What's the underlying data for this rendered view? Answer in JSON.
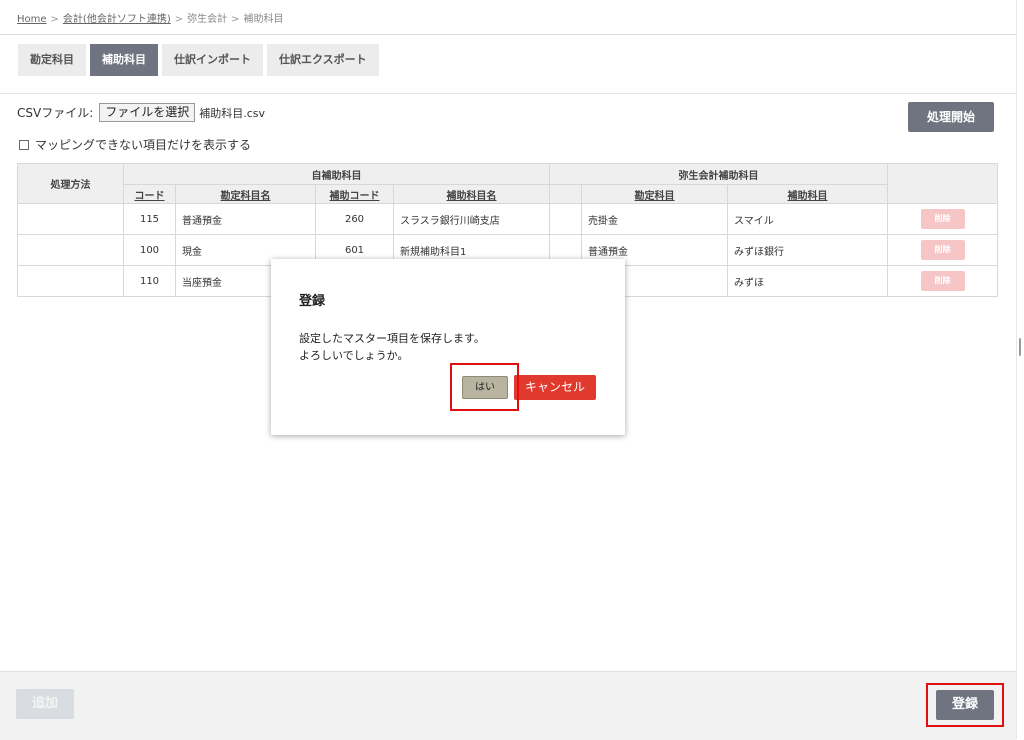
{
  "breadcrumb": {
    "home": "Home",
    "accounting": "会計(他会計ソフト連携)",
    "yayoi": "弥生会計",
    "current": "補助科目",
    "separator": ">"
  },
  "tabs": [
    {
      "label": "勘定科目",
      "active": false
    },
    {
      "label": "補助科目",
      "active": true
    },
    {
      "label": "仕訳インポート",
      "active": false
    },
    {
      "label": "仕訳エクスポート",
      "active": false
    }
  ],
  "csv": {
    "label": "CSVファイル:",
    "button": "ファイルを選択",
    "filename": "補助科目.csv"
  },
  "filter": {
    "label": "マッピングできない項目だけを表示する",
    "checked": false
  },
  "start_button": "処理開始",
  "table": {
    "group_headers": {
      "method": "処理方法",
      "own": "自補助科目",
      "yayoi": "弥生会計補助科目"
    },
    "columns": {
      "code": "コード",
      "account_name": "勘定科目名",
      "sub_code": "補助コード",
      "sub_name": "補助科目名",
      "y_account": "勘定科目",
      "y_sub": "補助科目"
    },
    "rows": [
      {
        "method": "",
        "code": "115",
        "account_name": "普通預金",
        "sub_code": "260",
        "sub_name": "スラスラ銀行川崎支店",
        "y_account": "売掛金",
        "y_sub": "スマイル",
        "delete": "削除"
      },
      {
        "method": "",
        "code": "100",
        "account_name": "現金",
        "sub_code": "601",
        "sub_name": "新規補助科目1",
        "y_account": "普通預金",
        "y_sub": "みずほ銀行",
        "delete": "削除"
      },
      {
        "method": "",
        "code": "110",
        "account_name": "当座預金",
        "sub_code": "",
        "sub_name": "",
        "y_account": "",
        "y_sub": "みずほ",
        "delete": "削除"
      }
    ]
  },
  "footer": {
    "add_button": "追加",
    "register_button": "登録"
  },
  "modal": {
    "title": "登録",
    "line1": "設定したマスター項目を保存します。",
    "line2": "よろしいでしょうか。",
    "yes_button": "はい",
    "cancel_button": "キャンセル"
  },
  "colors": {
    "accent": "#6f7480",
    "cancel": "#e0392d",
    "highlight": "#e01010",
    "delete_disabled": "#f6c6c6"
  }
}
